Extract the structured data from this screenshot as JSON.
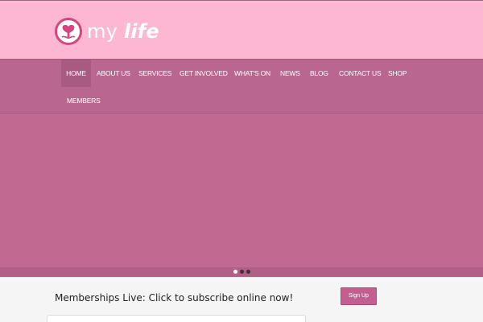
{
  "brand": {
    "name_part1": "my",
    "name_part2": "life",
    "logo_icon": "heart-tree-icon"
  },
  "nav": {
    "items": [
      {
        "label": "HOME",
        "active": true
      },
      {
        "label": "ABOUT US"
      },
      {
        "label": "SERVICES"
      },
      {
        "label": "GET INVOLVED"
      },
      {
        "label": "WHAT'S ON"
      },
      {
        "label": "NEWS"
      },
      {
        "label": "BLOG"
      },
      {
        "label": "CONTACT US"
      },
      {
        "label": "SHOP"
      },
      {
        "label": "MEMBERS"
      }
    ]
  },
  "slider": {
    "slide_count": 3,
    "active_slide": 1
  },
  "cta": {
    "text": "Memberships Live: Click to subscribe online now!",
    "button_label": "Sign Up"
  },
  "colors": {
    "header_bg": "#fdb7d3",
    "nav_bg": "#b96790",
    "slider_bg": "#c06991",
    "accent": "#c25f90"
  }
}
